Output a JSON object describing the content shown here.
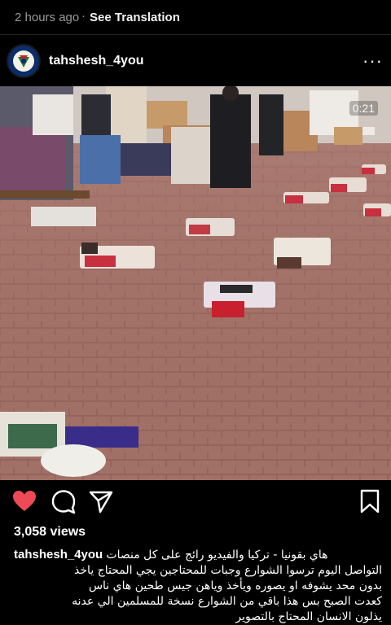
{
  "post": {
    "timestamp": "2 hours ago",
    "see_translation": "See Translation",
    "username": "tahshesh_4you",
    "more_icon": "···",
    "video_time": "0:21",
    "views": "3,058 views",
    "liked": true,
    "caption_user": "tahshesh_4you",
    "caption_lines": [
      "هاي بقونيا - تركيا والفيديو رائج  على كل منصات",
      "التواصل اليوم  ترسوا الشوارع وجبات للمحتاجين يجي المحتاج ياخذ",
      "بدون محد يشوفه  او يصوره ويأخذ وياهن جيس طحين  هاي ناس",
      "كعدت الصبح بس هذا باقي من الشوارع نسخة للمسلمين الي عدنه",
      "يذلون الانسان المحتاج بالتصوير"
    ]
  },
  "colors": {
    "background": "#000000",
    "heart": "#ed4956",
    "muted_text": "#9a9a9a"
  },
  "icons": [
    "heart-icon",
    "comment-icon",
    "share-icon",
    "bookmark-icon",
    "more-icon"
  ]
}
